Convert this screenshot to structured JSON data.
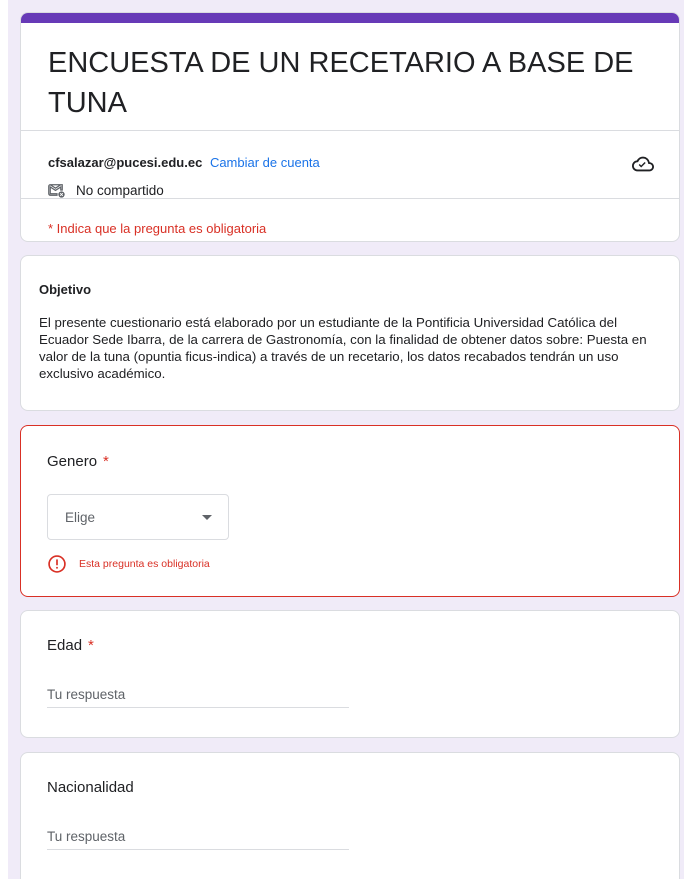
{
  "form": {
    "title": "ENCUESTA DE UN RECETARIO A BASE DE TUNA",
    "accent_color": "#673ab7"
  },
  "account": {
    "email": "cfsalazar@pucesi.edu.ec",
    "switch_label": "Cambiar de cuenta",
    "shared_status": "No compartido",
    "cloud_icon": "cloud-saved-icon"
  },
  "required_note": "* Indica que la pregunta es obligatoria",
  "objective": {
    "title": "Objetivo",
    "body": "El presente cuestionario está elaborado por un estudiante de la Pontificia Universidad Católica del Ecuador Sede Ibarra, de la carrera de Gastronomía, con la finalidad de obtener datos sobre: Puesta en valor de la tuna (opuntia ficus-indica) a través de un recetario, los datos recabados tendrán un uso exclusivo académico."
  },
  "questions": {
    "genero": {
      "label": "Genero",
      "required_mark": "*",
      "dropdown_value": "Elige",
      "error_message": "Esta pregunta es obligatoria",
      "error_color": "#d93025"
    },
    "edad": {
      "label": "Edad",
      "required_mark": "*",
      "placeholder": "Tu respuesta",
      "value": ""
    },
    "nacionalidad": {
      "label": "Nacionalidad",
      "placeholder": "Tu respuesta",
      "value": ""
    }
  }
}
